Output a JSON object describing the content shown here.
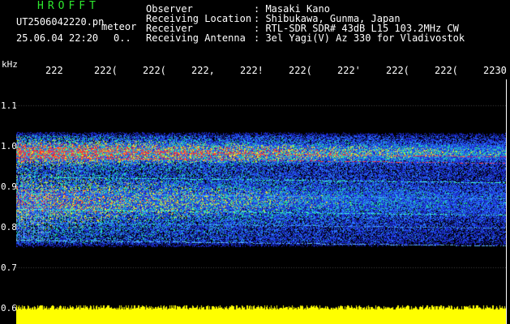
{
  "header": {
    "app_title": "HROFFT",
    "file_name": "UT2506042220.pn",
    "tag": "meteor",
    "datetime": "25.06.04 22:20",
    "datetime_extra": "0..",
    "meta": [
      {
        "label": "Observer",
        "value": ": Masaki Kano"
      },
      {
        "label": "Receiving Location",
        "value": ": Shibukawa, Gunma, Japan"
      },
      {
        "label": "Receiver",
        "value": ": RTL-SDR SDR# 43dB L15 103.2MHz CW"
      },
      {
        "label": "Receiving Antenna",
        "value": ": 3el Yagi(V) Az 330 for Vladivostok"
      }
    ]
  },
  "axis": {
    "y_unit": "kHz",
    "x_ticks": [
      "222",
      "222(",
      "222(",
      "222,",
      "222!",
      "222(",
      "222'",
      "222(",
      "222(",
      "2230"
    ],
    "y_ticks": [
      "1.1",
      "1.0",
      "0.9",
      "0.8",
      "0.7",
      "0.6"
    ]
  },
  "colors": {
    "background": "#000000",
    "title": "#2ee82e",
    "text": "#ffffff",
    "noise": "#ffff00",
    "signal_low": "#1a2aff",
    "signal_mid": "#22e0a0",
    "signal_high": "#ff3030"
  }
}
